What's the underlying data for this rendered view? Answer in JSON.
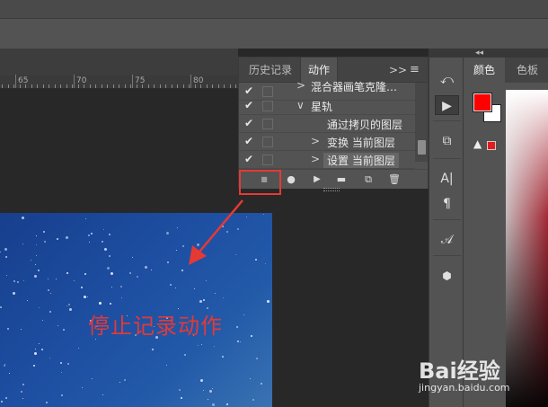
{
  "ruler": {
    "labels": [
      "65",
      "70",
      "75",
      "80"
    ]
  },
  "actions_panel": {
    "tabs": {
      "history": "历史记录",
      "actions": "动作"
    },
    "collapse_glyph": ">>",
    "menu_glyph": "≡",
    "rows": [
      {
        "label": "混合器画笔克隆…",
        "expand": ">",
        "checked": true,
        "selected": false
      },
      {
        "label": "星轨",
        "expand": "∨",
        "checked": true,
        "selected": false
      },
      {
        "label": "通过拷贝的图层",
        "expand": "",
        "checked": true,
        "selected": false
      },
      {
        "label": "变换 当前图层",
        "expand": ">",
        "checked": true,
        "selected": false
      },
      {
        "label": "设置 当前图层",
        "expand": ">",
        "checked": true,
        "selected": true
      }
    ],
    "check_glyph": "✔",
    "footer": {
      "stop": "■",
      "record": "●",
      "play": "▶",
      "new_set": "▬",
      "new_action": "⧉",
      "delete": "🗑"
    }
  },
  "tools": [
    "⤺",
    "▶",
    "⧉",
    "A|",
    "¶",
    "𝒜",
    "⬢"
  ],
  "color_panel": {
    "tabs": {
      "color": "颜色",
      "swatches": "色板"
    },
    "foreground": "#ff0000",
    "background": "#ffffff",
    "gamut_warning_glyph": "▲",
    "gamut_warning_color": "#e31b1b"
  },
  "annotation": {
    "caption": "停止记录动作",
    "color": "#e53935"
  },
  "watermark": {
    "brand": "Bai经验",
    "url": "jingyan.baidu.com"
  }
}
